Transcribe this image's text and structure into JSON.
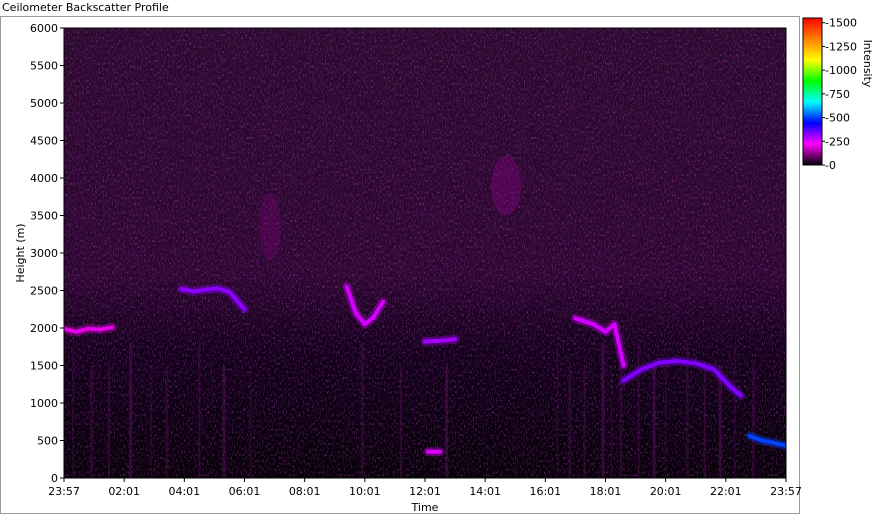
{
  "window": {
    "title": "Ceilometer Backscatter Profile"
  },
  "colors": {
    "plot_background": "#050006",
    "backscatter_magenta": "#c81ed2",
    "strong_layer_blue": "#3a3cff"
  },
  "chart_data": {
    "type": "heatmap",
    "title": "",
    "xlabel": "Time",
    "ylabel": "Height (m)",
    "x_tick_labels": [
      "23:57",
      "02:01",
      "04:01",
      "06:01",
      "08:01",
      "10:01",
      "12:01",
      "14:01",
      "16:01",
      "18:01",
      "20:01",
      "22:01",
      "23:57"
    ],
    "y_ticks": [
      0,
      500,
      1000,
      1500,
      2000,
      2500,
      3000,
      3500,
      4000,
      4500,
      5000,
      5500,
      6000
    ],
    "ylim": [
      0,
      6000
    ],
    "colorbar": {
      "label": "Intensity",
      "range": [
        0,
        1550
      ],
      "ticks": [
        0,
        250,
        500,
        750,
        1000,
        1250,
        1500
      ],
      "tick_labels": [
        "-0",
        "-250",
        "-500",
        "-750",
        "-1000",
        "-1250",
        "-1500"
      ],
      "colors": [
        "#000000",
        "#ff00ff",
        "#0000ff",
        "#00ffff",
        "#00ff00",
        "#ffff00",
        "#ff8000",
        "#ff0000"
      ]
    },
    "layers": [
      {
        "name": "",
        "x_hours": [
          0.0,
          0.4,
          0.8,
          1.2,
          1.6
        ],
        "heights": [
          1990,
          1950,
          1990,
          1980,
          2010
        ],
        "intensity": 200
      },
      {
        "name": "",
        "x_hours": [
          3.9,
          4.3,
          4.7,
          5.1,
          5.5,
          6.0
        ],
        "heights": [
          2520,
          2490,
          2510,
          2530,
          2480,
          2250
        ],
        "intensity": 320
      },
      {
        "name": "",
        "x_hours": [
          9.4,
          9.7,
          10.0,
          10.3,
          10.6
        ],
        "heights": [
          2550,
          2200,
          2050,
          2150,
          2350
        ],
        "intensity": 260
      },
      {
        "name": "",
        "x_hours": [
          12.0,
          12.5,
          13.0
        ],
        "heights": [
          1820,
          1830,
          1850
        ],
        "intensity": 300
      },
      {
        "name": "",
        "x_hours": [
          12.1,
          12.3,
          12.5
        ],
        "heights": [
          350,
          350,
          350
        ],
        "intensity": 250
      },
      {
        "name": "",
        "x_hours": [
          17.0,
          17.6,
          18.0,
          18.3,
          18.6
        ],
        "heights": [
          2130,
          2050,
          1950,
          2050,
          1500
        ],
        "intensity": 260
      },
      {
        "name": "",
        "x_hours": [
          18.6,
          19.2,
          19.8,
          20.4,
          21.0,
          21.6,
          22.2,
          22.5
        ],
        "heights": [
          1300,
          1450,
          1540,
          1560,
          1530,
          1450,
          1200,
          1100
        ],
        "intensity": 330
      },
      {
        "name": "",
        "x_hours": [
          22.8,
          23.2,
          23.6,
          24.0
        ],
        "heights": [
          560,
          500,
          470,
          430
        ],
        "intensity": 500
      }
    ],
    "diffuse_features": [
      {
        "x_hours": [
          6.5,
          7.2
        ],
        "heights": [
          2900,
          3800
        ],
        "intensity": 120
      },
      {
        "x_hours": [
          14.2,
          15.2
        ],
        "heights": [
          3500,
          4300
        ],
        "intensity": 140
      }
    ]
  }
}
